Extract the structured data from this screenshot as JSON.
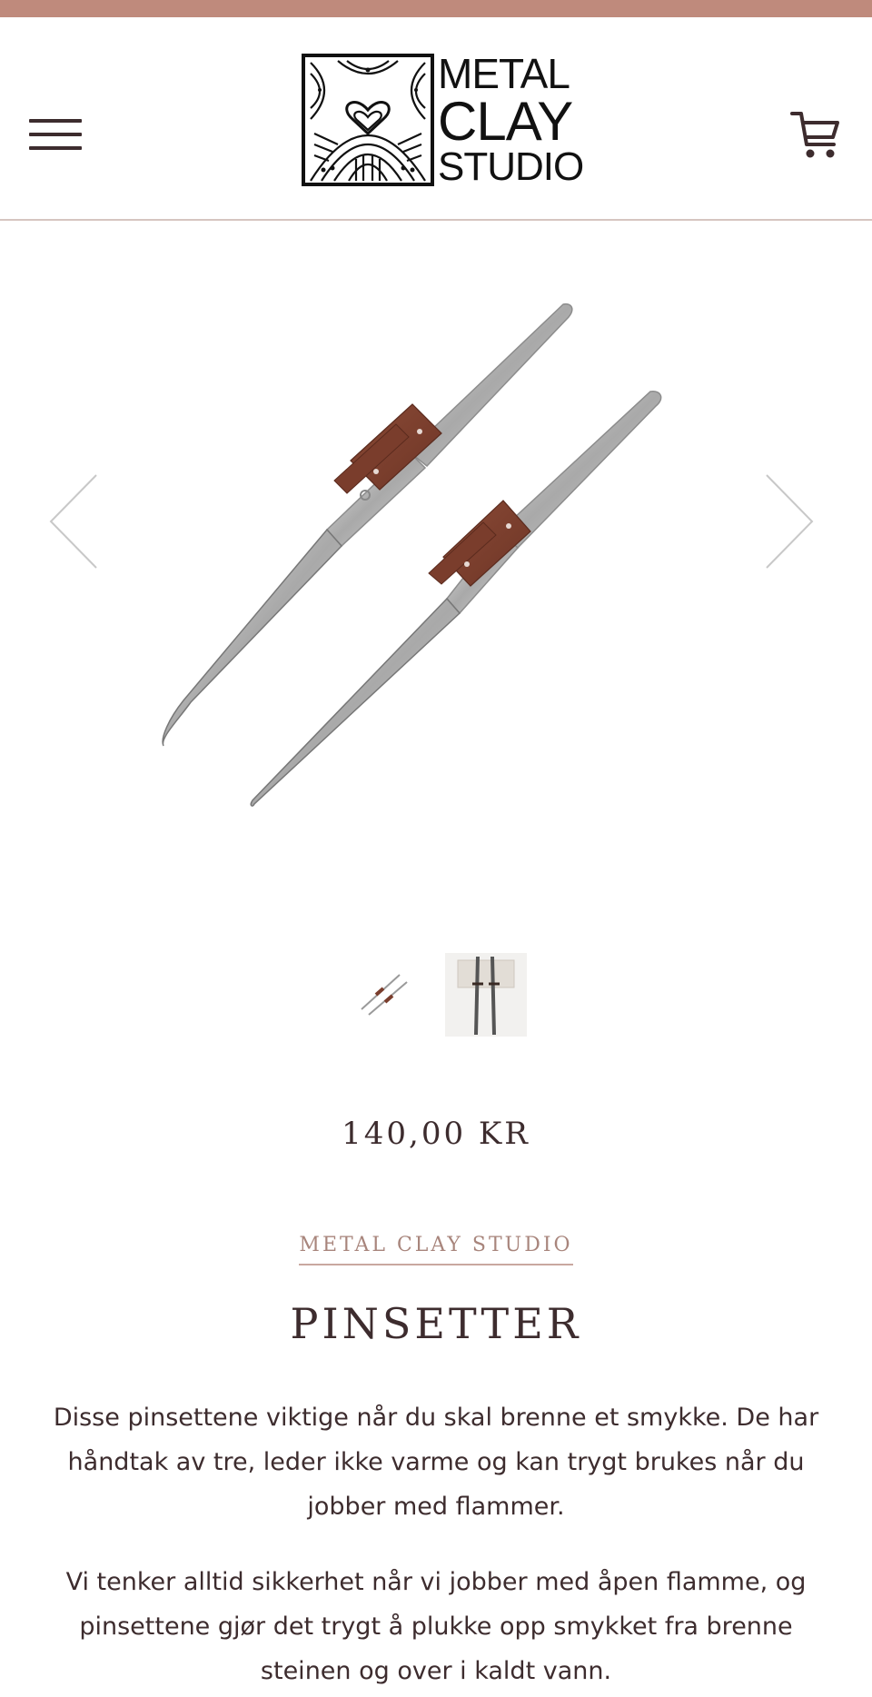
{
  "header": {
    "menu_icon": "hamburger-menu-icon",
    "logo": {
      "line1": "METAL",
      "line2": "CLAY",
      "line3": "STUDIO"
    },
    "cart_icon": "shopping-cart-icon",
    "accent_color": "#bf8a7c"
  },
  "gallery": {
    "prev_icon": "chevron-left-icon",
    "next_icon": "chevron-right-icon",
    "image_subject": "tweezers-product-image",
    "thumbnail_count": 2
  },
  "product": {
    "price": "140,00 KR",
    "vendor": "METAL CLAY STUDIO",
    "title": "PINSETTER",
    "description": [
      "Disse pinsettene viktige når du skal brenne et smykke. De har håndtak av tre, leder ikke varme og kan trygt brukes når du jobber med flammer.",
      "Vi tenker alltid sikkerhet når vi jobber med åpen flamme, og pinsettene gjør det trygt å plukke opp smykket fra brenne steinen og over i kaldt vann."
    ]
  }
}
